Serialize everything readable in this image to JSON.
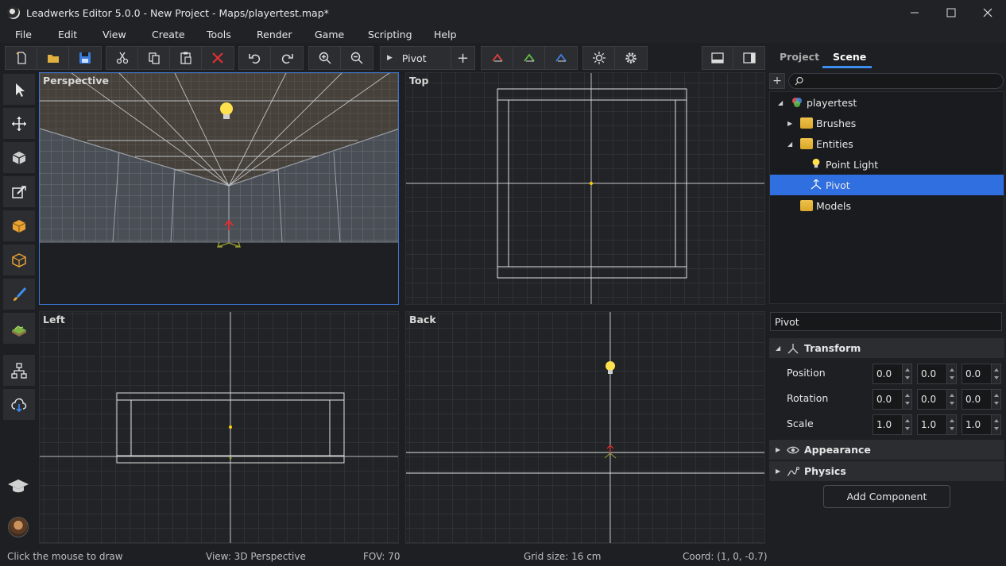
{
  "window": {
    "title": "Leadwerks Editor 5.0.0 - New Project - Maps/playertest.map*"
  },
  "menu": [
    "File",
    "Edit",
    "View",
    "Create",
    "Tools",
    "Render",
    "Game",
    "Scripting",
    "Help"
  ],
  "toolbar": {
    "entity_select": "Pivot"
  },
  "viewports": {
    "perspective": "Perspective",
    "top": "Top",
    "left": "Left",
    "back": "Back"
  },
  "right_panel": {
    "tabs": [
      "Project",
      "Scene"
    ],
    "active_tab": "Scene",
    "search_placeholder": "",
    "tree": [
      {
        "label": "playertest",
        "depth": 0,
        "expanded": true,
        "icon": "scene-icon"
      },
      {
        "label": "Brushes",
        "depth": 1,
        "expanded": false,
        "icon": "folder-icon"
      },
      {
        "label": "Entities",
        "depth": 1,
        "expanded": true,
        "icon": "folder-icon"
      },
      {
        "label": "Point Light",
        "depth": 2,
        "icon": "bulb-icon"
      },
      {
        "label": "Pivot",
        "depth": 2,
        "icon": "pivot-icon",
        "selected": true
      },
      {
        "label": "Models",
        "depth": 1,
        "icon": "folder-icon"
      }
    ],
    "name_field": "Pivot",
    "sections": {
      "transform": "Transform",
      "appearance": "Appearance",
      "physics": "Physics"
    },
    "properties": {
      "position": {
        "label": "Position",
        "values": [
          "0.0",
          "0.0",
          "0.0"
        ]
      },
      "rotation": {
        "label": "Rotation",
        "values": [
          "0.0",
          "0.0",
          "0.0"
        ]
      },
      "scale": {
        "label": "Scale",
        "values": [
          "1.0",
          "1.0",
          "1.0"
        ]
      }
    },
    "add_component": "Add Component"
  },
  "status": {
    "hint": "Click the mouse to draw",
    "view": "View: 3D Perspective",
    "fov": "FOV: 70",
    "grid": "Grid size: 16 cm",
    "coord": "Coord: (1, 0, -0.7)"
  },
  "colors": {
    "accent": "#2f6fe0",
    "tab_underline": "#3d8ef0",
    "background": "#1e1f22",
    "panel": "#2b2d31"
  }
}
